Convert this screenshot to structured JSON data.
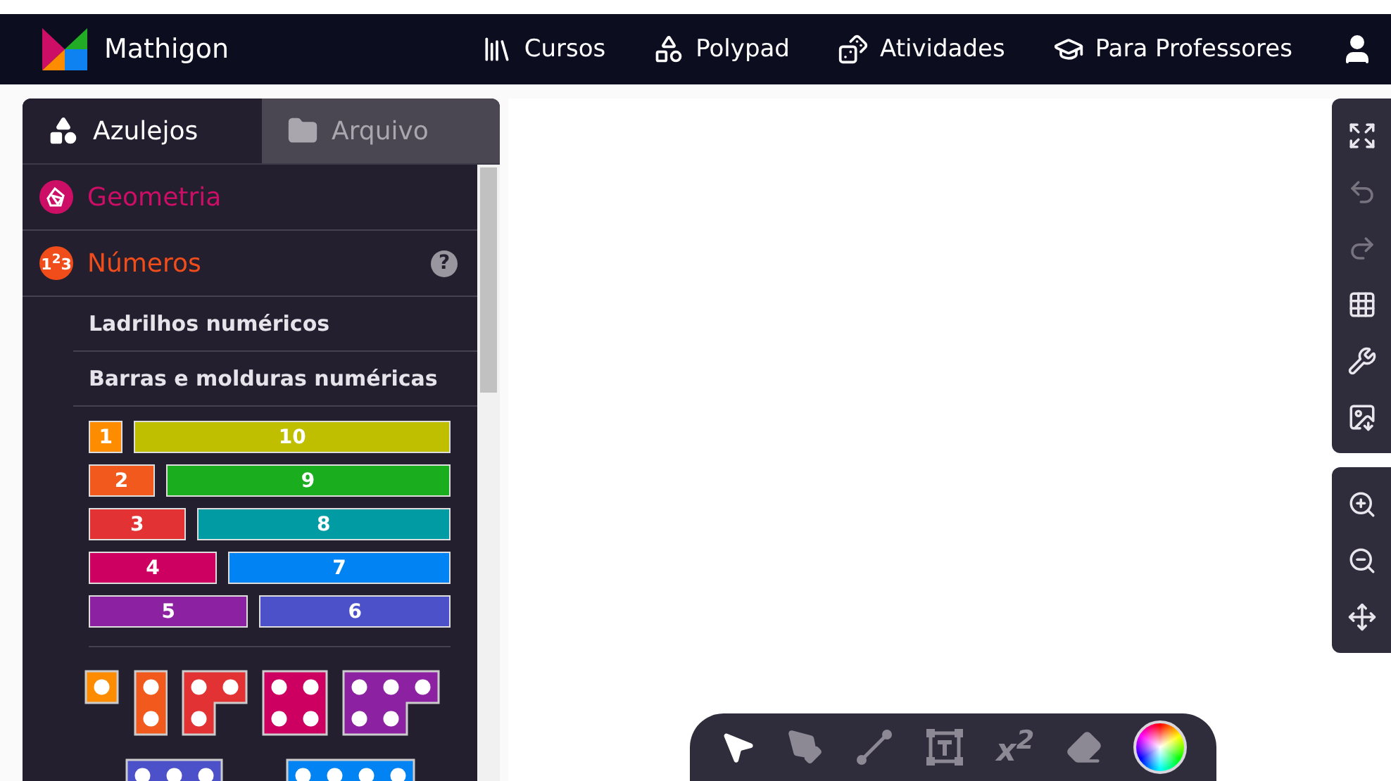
{
  "nav": {
    "brand": "Mathigon",
    "links": [
      {
        "kind": "courses",
        "label": "Cursos"
      },
      {
        "kind": "polypad",
        "label": "Polypad"
      },
      {
        "kind": "activities",
        "label": "Atividades"
      },
      {
        "kind": "teachers",
        "label": "Para Professores"
      }
    ]
  },
  "sidebar": {
    "tabs": [
      {
        "kind": "tiles",
        "label": "Azulejos",
        "selected": true
      },
      {
        "kind": "files",
        "label": "Arquivo",
        "selected": false
      }
    ],
    "categories": [
      {
        "kind": "geometry",
        "label": "Geometria",
        "color": "#cd0e66"
      },
      {
        "kind": "numbers",
        "label": "Números",
        "badge": "1$^{2}$3",
        "color": "#f04d1a",
        "help": "?",
        "children": [
          {
            "label": "Ladrilhos numéricos"
          },
          {
            "label": "Barras e molduras numéricas"
          }
        ]
      }
    ],
    "number_bars": [
      [
        {
          "label": "1",
          "color": "#fd8c00"
        },
        {
          "label": "10",
          "color": "#bfbf00"
        }
      ],
      [
        {
          "label": "2",
          "color": "#f15a1c"
        },
        {
          "label": "9",
          "color": "#1aae1f"
        }
      ],
      [
        {
          "label": "3",
          "color": "#e33233"
        },
        {
          "label": "8",
          "color": "#009ba3"
        }
      ],
      [
        {
          "label": "4",
          "color": "#cd0062"
        },
        {
          "label": "7",
          "color": "#0183f3"
        }
      ],
      [
        {
          "label": "5",
          "color": "#8c22a2"
        },
        {
          "label": "6",
          "color": "#4c50c9"
        }
      ]
    ],
    "dot_tiles": [
      {
        "color": "#fd8c00"
      },
      {
        "color": "#f15a1c"
      },
      {
        "color": "#e33233"
      },
      {
        "color": "#cd0062"
      },
      {
        "color": "#8c22a2"
      }
    ],
    "dot_tiles_cut": [
      {
        "color": "#4c50c9"
      },
      {
        "color": "#0183f3"
      }
    ]
  },
  "side_tools": [
    [
      {
        "kind": "fullscreen",
        "disabled": false
      },
      {
        "kind": "undo",
        "disabled": true
      },
      {
        "kind": "redo",
        "disabled": true
      },
      {
        "kind": "grid",
        "disabled": false
      },
      {
        "kind": "tools",
        "disabled": false
      },
      {
        "kind": "export",
        "disabled": false
      }
    ],
    [
      {
        "kind": "zoom-in",
        "disabled": false
      },
      {
        "kind": "zoom-out",
        "disabled": false
      },
      {
        "kind": "pan",
        "disabled": false
      }
    ]
  ],
  "bottom_tools": [
    {
      "kind": "select",
      "selected": true
    },
    {
      "kind": "pen",
      "selected": false
    },
    {
      "kind": "line",
      "selected": false
    },
    {
      "kind": "text",
      "selected": false
    },
    {
      "kind": "equation",
      "label": "x$^{2}$",
      "selected": false
    },
    {
      "kind": "eraser",
      "selected": false
    },
    {
      "kind": "color",
      "selected": false
    }
  ]
}
